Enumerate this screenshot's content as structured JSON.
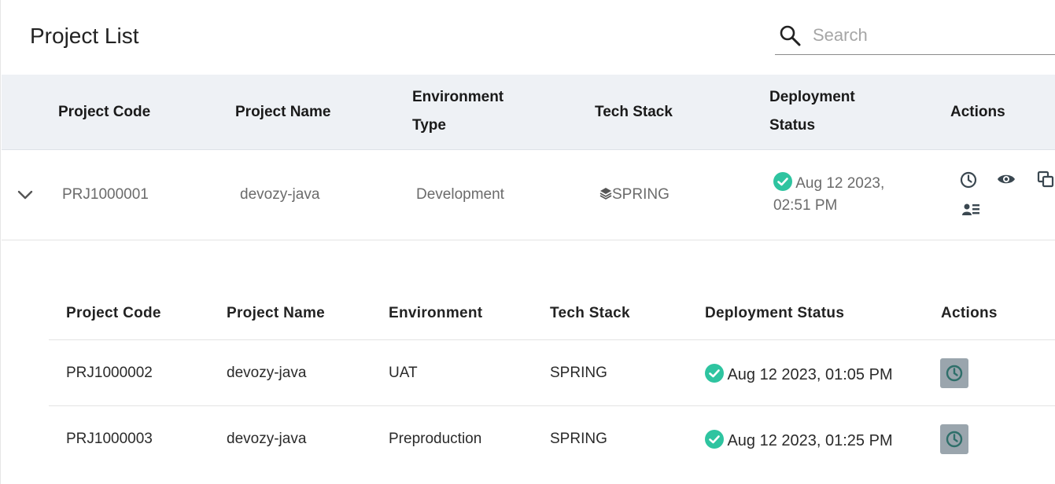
{
  "page": {
    "title": "Project List"
  },
  "search": {
    "placeholder": "Search"
  },
  "main_table": {
    "headers": {
      "code": "Project Code",
      "name": "Project Name",
      "env_line1": "Environment",
      "env_line2": "Type",
      "stack": "Tech Stack",
      "deploy_line1": "Deployment",
      "deploy_line2": "Status",
      "actions": "Actions"
    },
    "row": {
      "code": "PRJ1000001",
      "name": "devozy-java",
      "env": "Development",
      "stack": "SPRING",
      "status_line1": "Aug 12 2023,",
      "status_line2": "02:51 PM"
    }
  },
  "sub_table": {
    "headers": {
      "code": "Project Code",
      "name": "Project Name",
      "env": "Environment",
      "stack": "Tech Stack",
      "deploy": "Deployment Status",
      "actions": "Actions"
    },
    "rows": [
      {
        "code": "PRJ1000002",
        "name": "devozy-java",
        "env": "UAT",
        "stack": "SPRING",
        "status": "Aug 12 2023, 01:05 PM"
      },
      {
        "code": "PRJ1000003",
        "name": "devozy-java",
        "env": "Preproduction",
        "stack": "SPRING",
        "status": "Aug 12 2023, 01:25 PM"
      }
    ]
  },
  "colors": {
    "success": "#2ec4a0",
    "header_bg": "#eef1f5",
    "icon_dark": "#3a4750",
    "history_btn_bg": "#9aa5ad",
    "history_icon": "#2f6f6a"
  },
  "icons": {
    "search": "search-icon",
    "expand": "chevron-down-icon",
    "stack": "layers-icon",
    "status": "check-circle-icon",
    "history": "clock-icon",
    "view": "eye-icon",
    "copy": "copy-icon",
    "users": "user-list-icon"
  }
}
